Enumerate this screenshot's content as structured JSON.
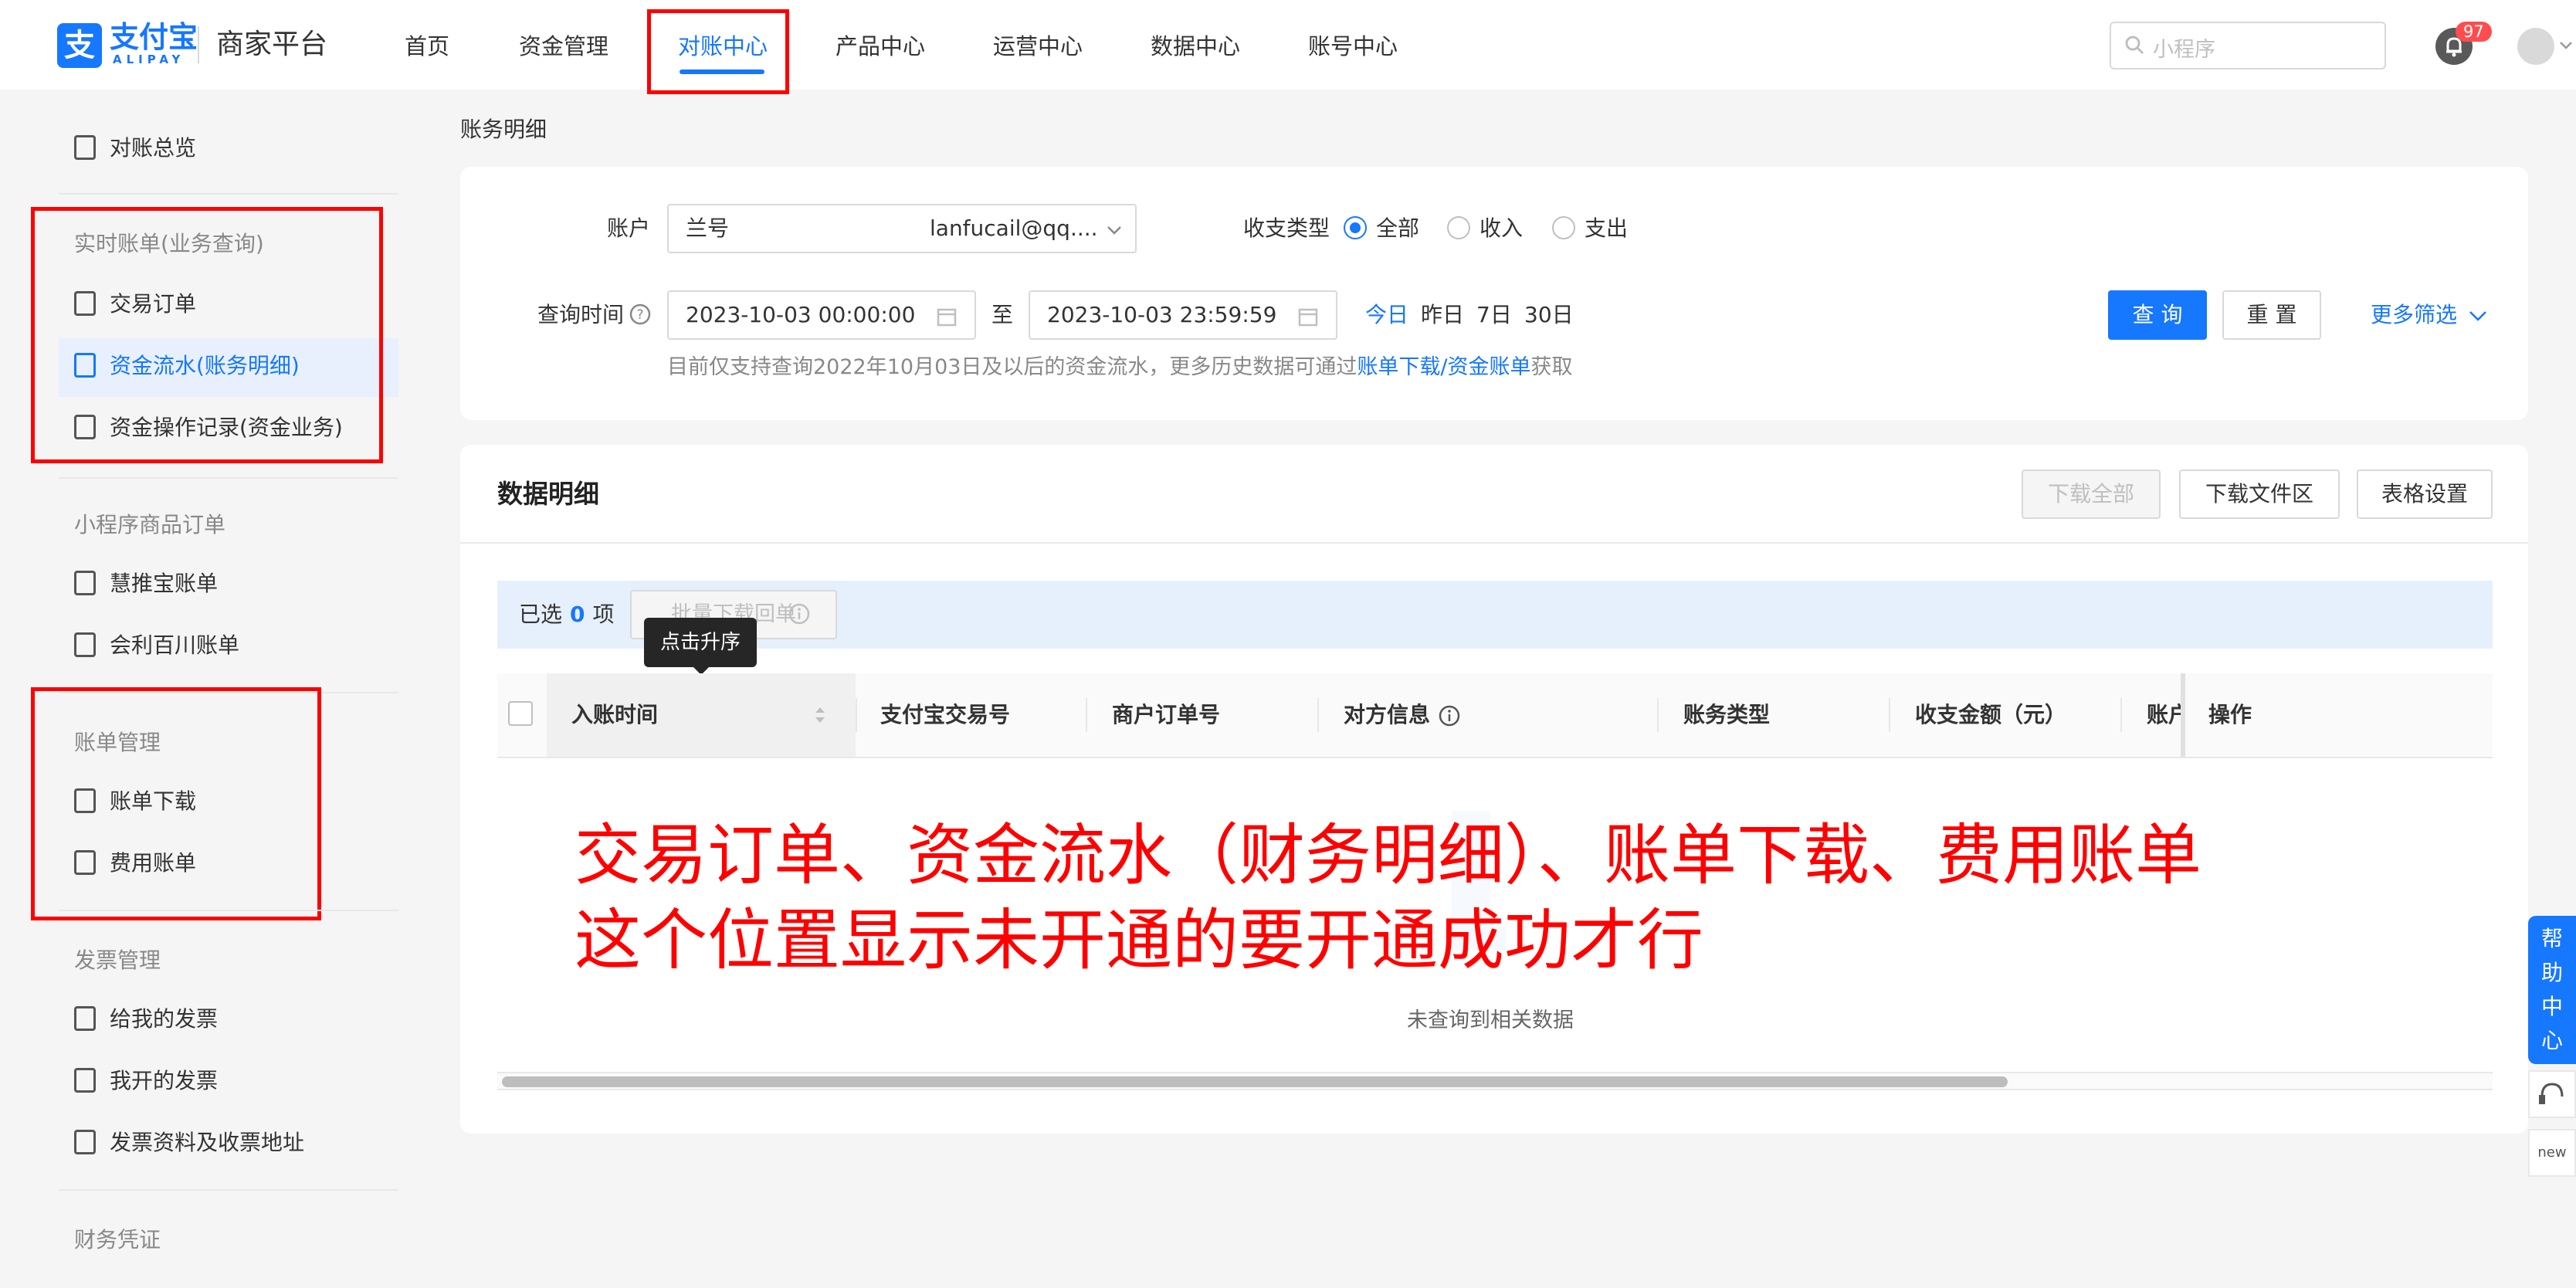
{
  "header": {
    "logo_cn": "支付宝",
    "logo_en": "ALIPAY",
    "platform": "商家平台",
    "nav": [
      "首页",
      "资金管理",
      "对账中心",
      "产品中心",
      "运营中心",
      "数据中心",
      "账号中心"
    ],
    "active_nav": "对账中心",
    "search_placeholder": "小程序",
    "notif_count": "97"
  },
  "sidebar": {
    "overview": "对账总览",
    "sections": [
      {
        "title": "实时账单(业务查询)",
        "items": [
          "交易订单",
          "资金流水(账务明细)",
          "资金操作记录(资金业务)"
        ]
      },
      {
        "title": "小程序商品订单",
        "items": [
          "慧推宝账单",
          "会利百川账单"
        ]
      },
      {
        "title": "账单管理",
        "items": [
          "账单下载",
          "费用账单"
        ]
      },
      {
        "title": "发票管理",
        "items": [
          "给我的发票",
          "我开的发票",
          "发票资料及收票地址"
        ]
      },
      {
        "title": "财务凭证",
        "items": []
      }
    ],
    "active_item": "资金流水(账务明细)"
  },
  "main": {
    "page_title": "账务明细",
    "filter": {
      "account_label": "账户",
      "account_name": "兰号",
      "account_email": "lanfucail@qq....",
      "type_label": "收支类型",
      "type_options": [
        "全部",
        "收入",
        "支出"
      ],
      "type_selected": "全部",
      "time_label": "查询时间",
      "start_time": "2023-10-03 00:00:00",
      "to": "至",
      "end_time": "2023-10-03 23:59:59",
      "quick_ranges": [
        "今日",
        "昨日",
        "7日",
        "30日"
      ],
      "query_button": "查 询",
      "reset_button": "重 置",
      "more_filter": "更多筛选",
      "hint_prefix": "目前仅支持查询2022年10月03日及以后的资金流水，更多历史数据可通过",
      "hint_link": "账单下载/资金账单",
      "hint_suffix": "获取"
    },
    "data": {
      "title": "数据明细",
      "download_all": "下载全部",
      "download_area": "下载文件区",
      "table_settings": "表格设置",
      "selected_prefix": "已选",
      "selected_count": "0",
      "selected_suffix": "项",
      "batch_download": "批量下载回单",
      "tooltip": "点击升序",
      "columns": [
        "入账时间",
        "支付宝交易号",
        "商户订单号",
        "对方信息",
        "账务类型",
        "收支金额（元）",
        "账户",
        "操作"
      ],
      "empty_text": "未查询到相关数据"
    }
  },
  "annotation": {
    "line1": "交易订单、资金流水（财务明细）、账单下载、费用账单",
    "line2": "这个位置显示未开通的要开通成功才行"
  },
  "help": {
    "label": "帮助中心",
    "new_label": "new"
  }
}
